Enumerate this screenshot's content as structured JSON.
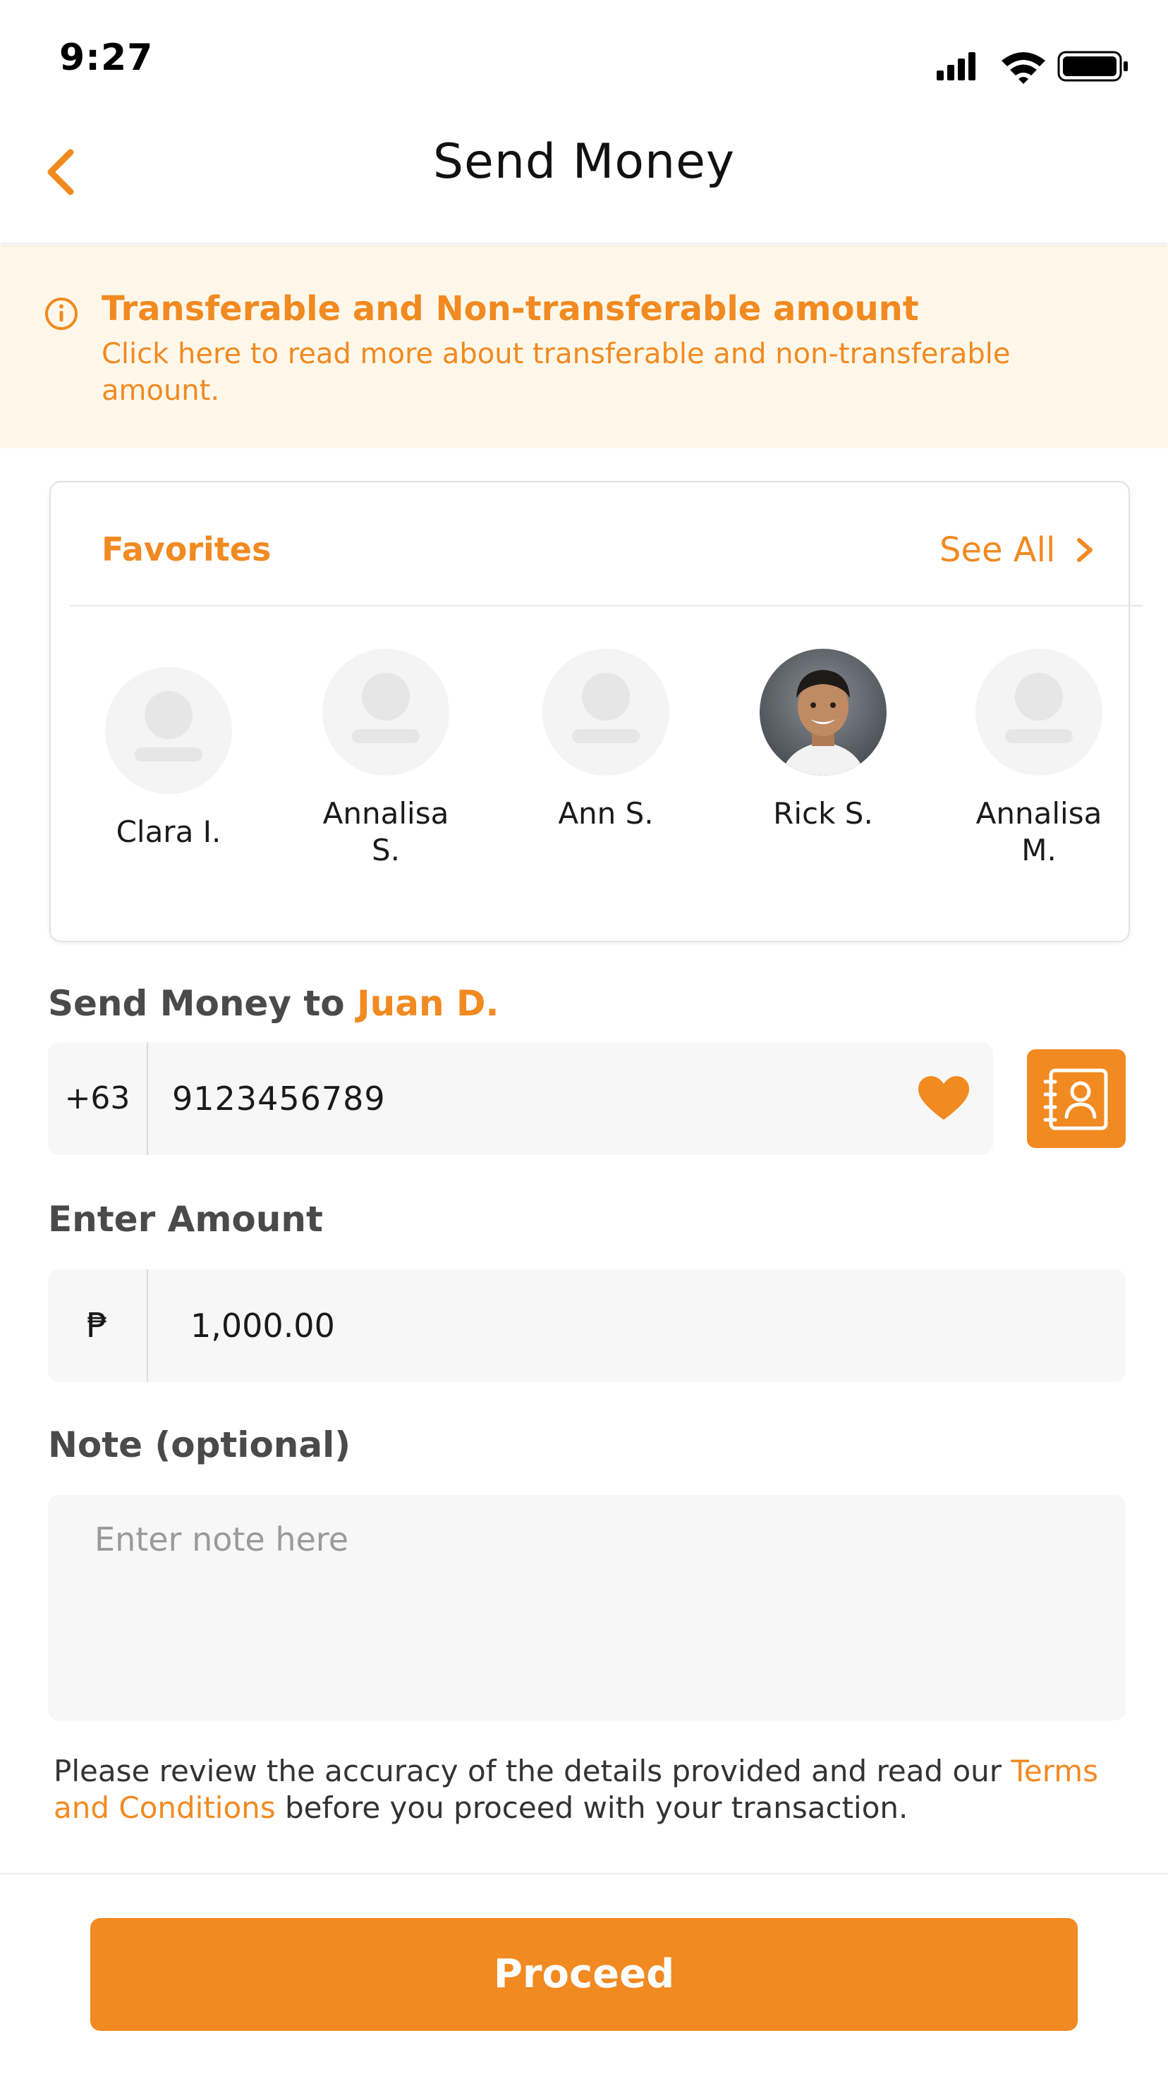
{
  "status_bar": {
    "time": "9:27"
  },
  "header": {
    "title": "Send Money",
    "back_icon": "chevron-left-icon"
  },
  "info_banner": {
    "icon": "info-circle-icon",
    "title": "Transferable and Non-transferable amount",
    "description": "Click here to read more about transferable and non-transferable amount."
  },
  "favorites": {
    "title": "Favorites",
    "see_all_label": "See All",
    "items": [
      {
        "name": "Clara I.",
        "has_photo": false
      },
      {
        "name": "Annalisa\nS.",
        "has_photo": false
      },
      {
        "name": "Ann S.",
        "has_photo": false
      },
      {
        "name": "Rick S.",
        "has_photo": true
      },
      {
        "name": "Annalisa\nM.",
        "has_photo": false
      }
    ]
  },
  "send_to": {
    "label": "Send Money to",
    "recipient": "Juan D.",
    "country_code": "+63",
    "phone_number": "9123456789"
  },
  "amount": {
    "label": "Enter Amount",
    "currency_symbol": "₱",
    "value": "1,000.00"
  },
  "note": {
    "label": "Note (optional)",
    "placeholder": "Enter note here"
  },
  "disclaimer": {
    "before": "Please review the accuracy of the details provided and read our ",
    "link": "Terms and Conditions",
    "after": " before you proceed with your transaction."
  },
  "proceed_button": {
    "label": "Proceed"
  },
  "colors": {
    "accent": "#f18a21",
    "banner_bg": "#fff8ea",
    "field_bg": "#f7f7f7"
  }
}
